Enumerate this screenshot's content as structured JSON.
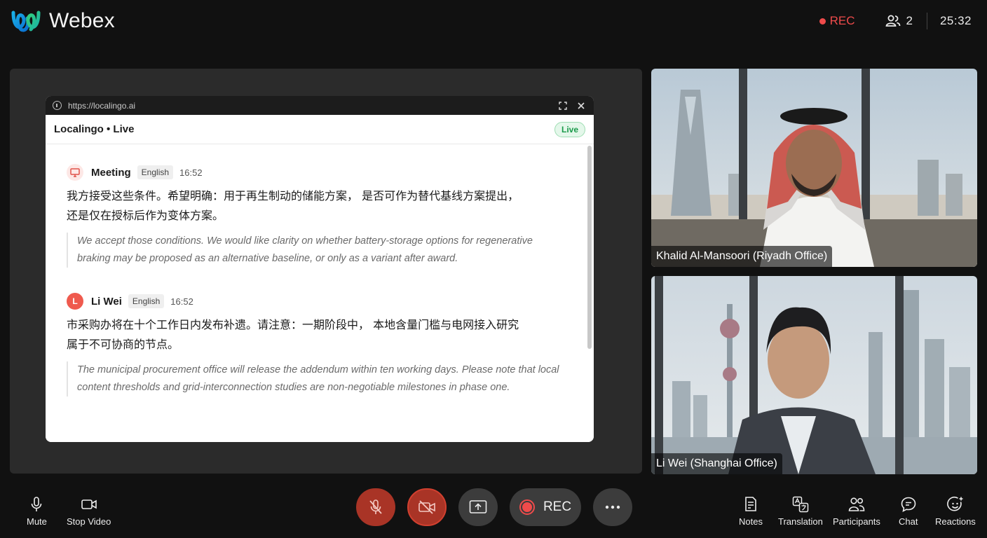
{
  "app": {
    "name": "Webex"
  },
  "header": {
    "rec_label": "REC",
    "participant_count": "2",
    "timer": "25:32"
  },
  "browser": {
    "url": "https://localingo.ai"
  },
  "localingo": {
    "title": "Localingo • Live",
    "status": "Live"
  },
  "transcript": [
    {
      "speaker": "Meeting",
      "language": "English",
      "time": "16:52",
      "original_line1": "我方接受这些条件。希望明确：用于再生制动的储能方案， 是否可作为替代基线方案提出，",
      "original_line2": "还是仅在授标后作为变体方案。",
      "translation": "We accept those conditions. We would like clarity on whether battery-storage options for regenerative braking may be proposed as an alternative baseline, or only as a variant after award."
    },
    {
      "speaker": "Li Wei",
      "avatar_initial": "L",
      "language": "English",
      "time": "16:52",
      "original_line1": "市采购办将在十个工作日内发布补遗。请注意：一期阶段中， 本地含量门槛与电网接入研究",
      "original_line2": "属于不可协商的节点。",
      "translation": "The municipal procurement office will release the addendum within ten working days. Please note that local content thresholds and grid-interconnection studies are non-negotiable milestones in phase one."
    }
  ],
  "participants": [
    {
      "name": "Khalid Al-Mansoori (Riyadh Office)"
    },
    {
      "name": "Li Wei (Shanghai Office)"
    }
  ],
  "toolbar": {
    "mute": "Mute",
    "stop_video": "Stop Video",
    "rec": "REC",
    "notes": "Notes",
    "translation": "Translation",
    "participants": "Participants",
    "chat": "Chat",
    "reactions": "Reactions"
  },
  "colors": {
    "accent_red": "#ef4b4b",
    "live_green": "#1a9a4a",
    "brand_blue": "#1e88e5"
  },
  "icons": [
    "webex-logo",
    "people-icon",
    "info-icon",
    "expand-icon",
    "close-icon",
    "screen-icon",
    "microphone-icon",
    "video-icon",
    "mic-off-icon",
    "video-off-icon",
    "share-icon",
    "more-icon",
    "notes-icon",
    "translation-icon",
    "participants-icon",
    "chat-icon",
    "reactions-icon"
  ]
}
